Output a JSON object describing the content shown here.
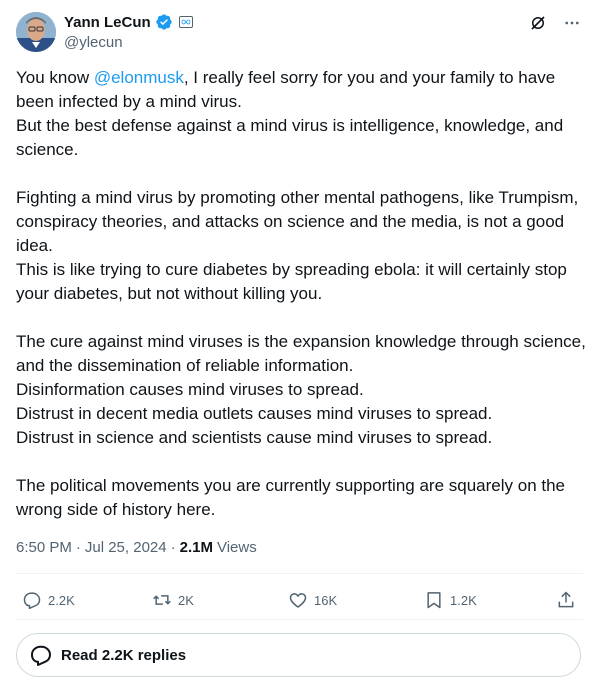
{
  "author": {
    "name": "Yann LeCun",
    "handle": "@ylecun"
  },
  "tweet": {
    "p1_before": "You know ",
    "mention": "@elonmusk",
    "p1_after": ", I really feel sorry for you and your family to have been infected by a mind virus.",
    "p2": "But the best defense against a mind virus is intelligence, knowledge, and science.",
    "p3": "Fighting a mind virus by promoting other mental pathogens, like Trumpism, conspiracy theories, and attacks on science and the media, is not a good idea.",
    "p4": "This is like trying to cure diabetes by spreading ebola: it will certainly stop your diabetes, but not without killing you.",
    "p5": "The cure against mind viruses is the expansion knowledge through science, and the dissemination of reliable information.",
    "p6": "Disinformation causes mind viruses to spread.",
    "p7": "Distrust in decent media outlets causes mind viruses to spread.",
    "p8": "Distrust in science and scientists cause mind viruses to spread.",
    "p9": "The political movements you are currently supporting are squarely on the wrong side of history here."
  },
  "meta": {
    "time": "6:50 PM",
    "dot1": "·",
    "date": "Jul 25, 2024",
    "dot2": "·",
    "views_count": "2.1M",
    "views_label": "Views"
  },
  "actions": {
    "replies": "2.2K",
    "reposts": "2K",
    "likes": "16K",
    "bookmarks": "1.2K"
  },
  "read_replies": "Read 2.2K replies",
  "colors": {
    "accent": "#1d9bf0",
    "text": "#0f1419",
    "muted": "#536471"
  }
}
